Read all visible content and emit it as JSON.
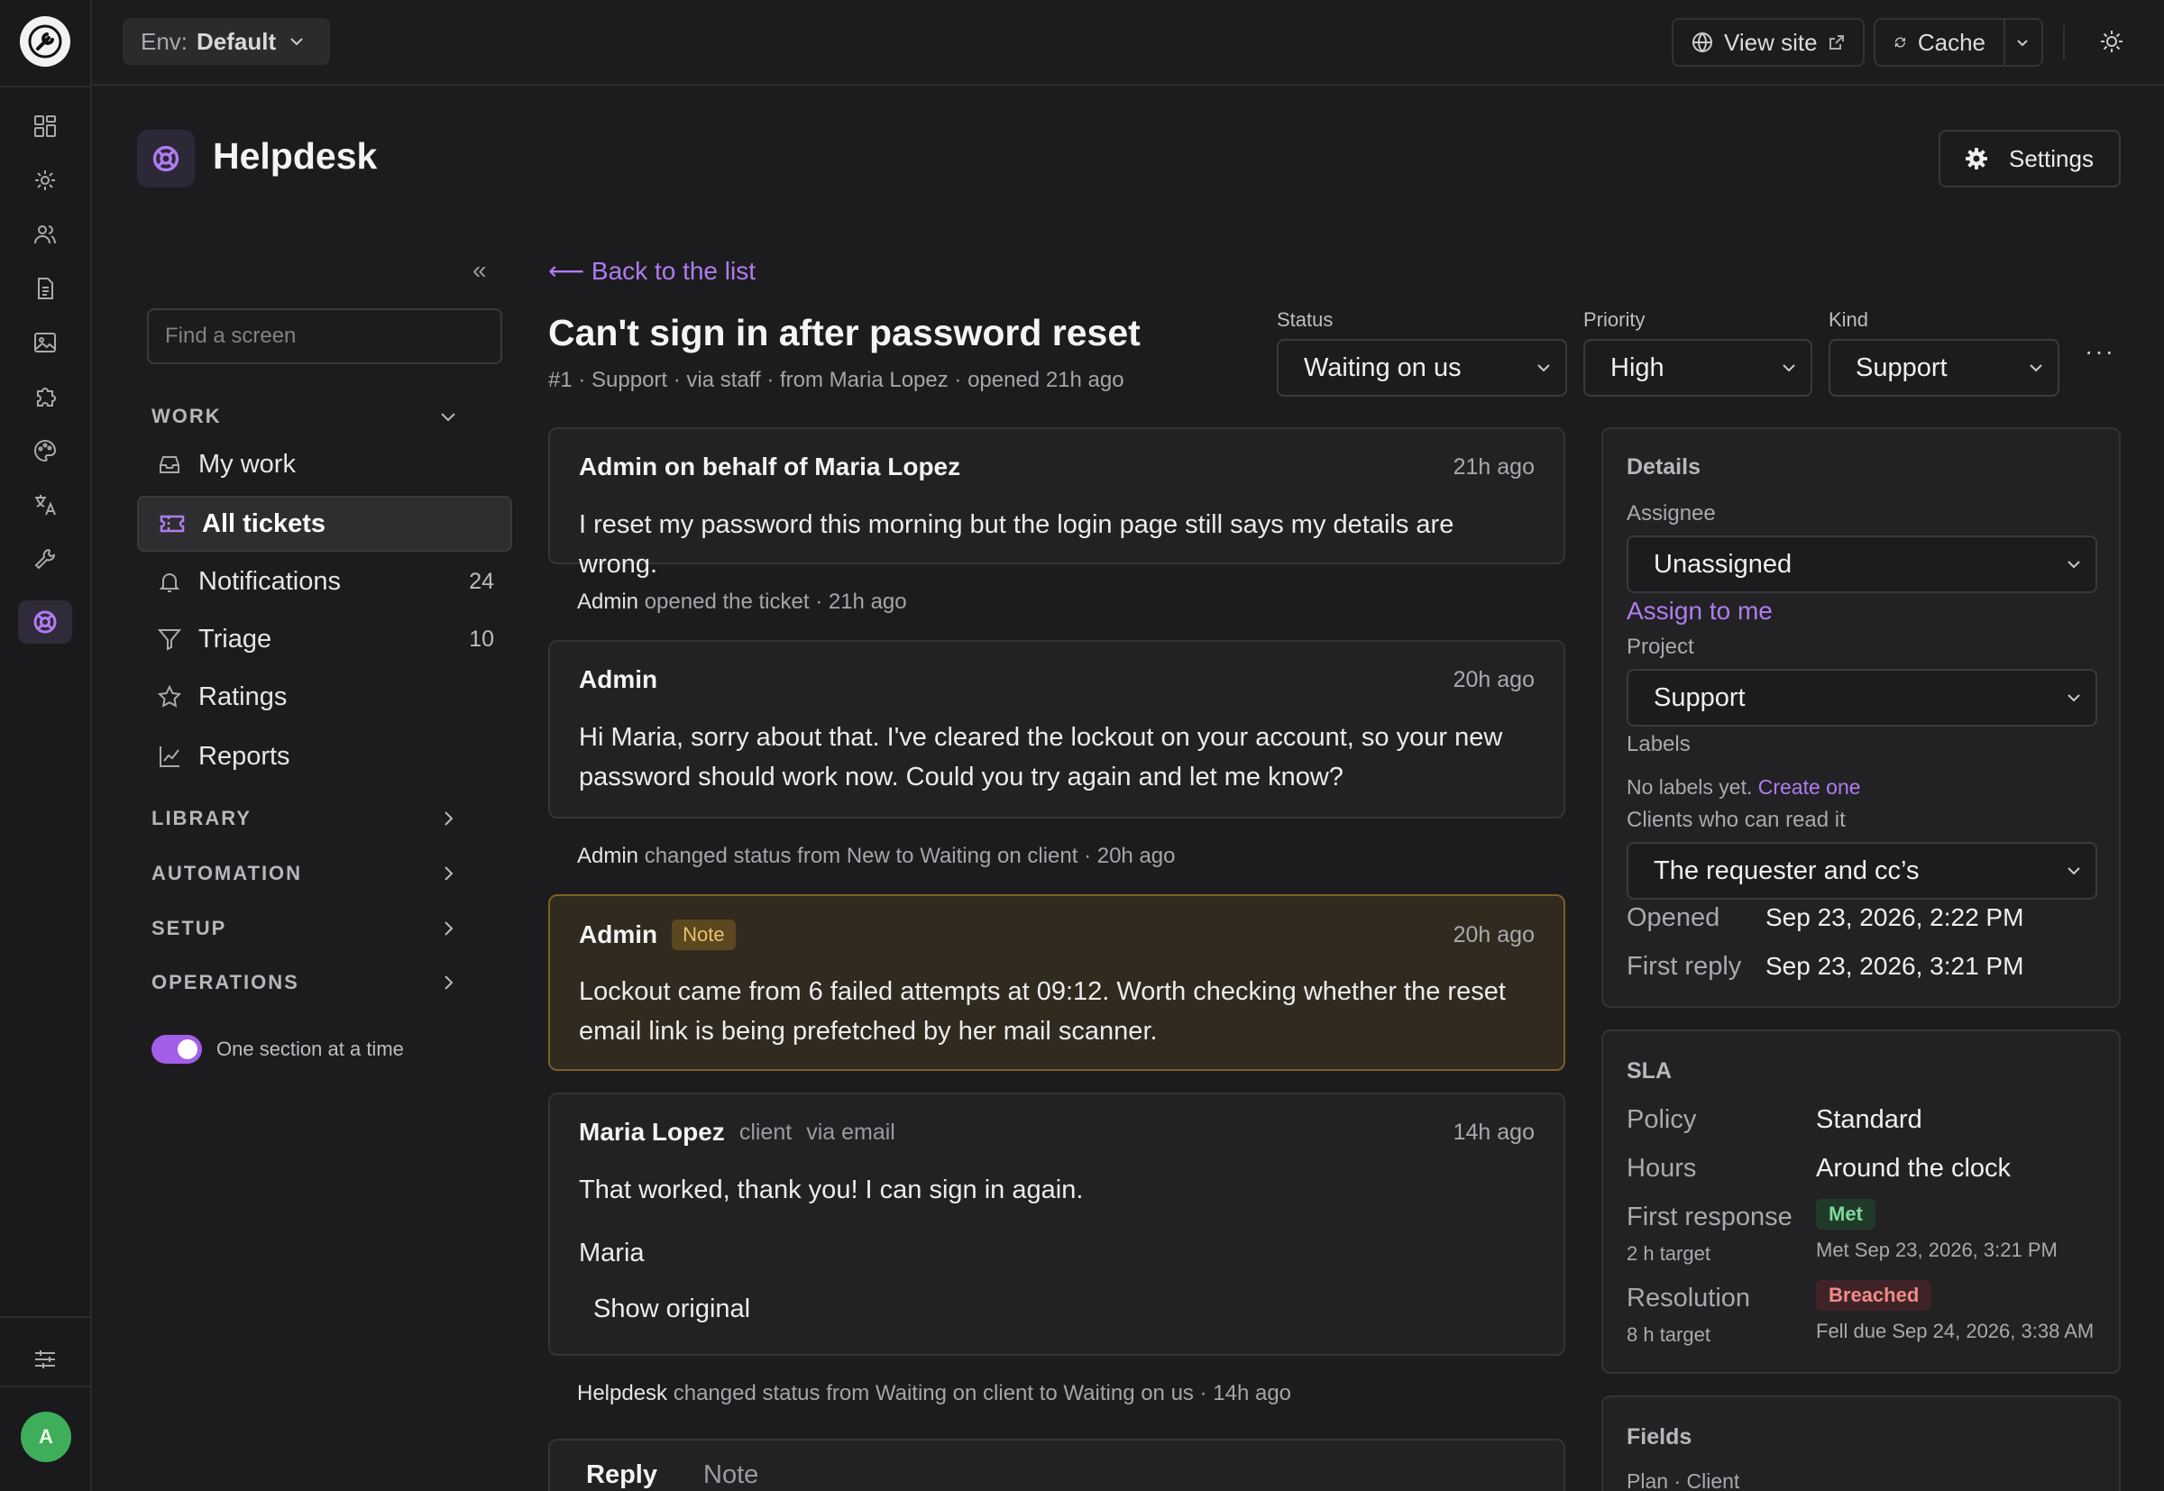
{
  "topbar": {
    "env_label": "Env:",
    "env_value": "Default",
    "view_site": "View site",
    "cache": "Cache"
  },
  "page": {
    "title": "Helpdesk",
    "settings": "Settings"
  },
  "sidebar": {
    "search_placeholder": "Find a screen",
    "work_label": "WORK",
    "items": [
      {
        "label": "My work",
        "count": "",
        "icon": "inbox-icon"
      },
      {
        "label": "All tickets",
        "count": "",
        "icon": "ticket-icon"
      },
      {
        "label": "Notifications",
        "count": "24",
        "icon": "bell-icon"
      },
      {
        "label": "Triage",
        "count": "10",
        "icon": "filter-icon"
      },
      {
        "label": "Ratings",
        "count": "",
        "icon": "star-icon"
      },
      {
        "label": "Reports",
        "count": "",
        "icon": "chart-icon"
      }
    ],
    "sections": [
      "LIBRARY",
      "AUTOMATION",
      "SETUP",
      "OPERATIONS"
    ],
    "toggle_label": "One section at a time",
    "toggle_on": true
  },
  "ticket": {
    "back": "⟵ Back to the list",
    "title": "Can't sign in after password reset",
    "meta": "#1 · Support · via staff · from Maria Lopez · opened 21h ago",
    "status_label": "Status",
    "status_value": "Waiting on us",
    "priority_label": "Priority",
    "priority_value": "High",
    "kind_label": "Kind",
    "kind_value": "Support",
    "more": "···"
  },
  "timeline": {
    "msg1": {
      "author": "Admin on behalf of Maria Lopez",
      "time": "21h ago",
      "body": "I reset my password this morning but the login page still says my details are wrong."
    },
    "event1": {
      "who": "Admin",
      "text": "opened the ticket",
      "time": "21h ago"
    },
    "msg2": {
      "author": "Admin",
      "time": "20h ago",
      "body": "Hi Maria, sorry about that. I've cleared the lockout on your account, so your new password should work now. Could you try again and let me know?"
    },
    "event2": {
      "who": "Admin",
      "text": "changed status from New to Waiting on client",
      "time": "20h ago"
    },
    "msg3": {
      "author": "Admin",
      "badge": "Note",
      "time": "20h ago",
      "body": "Lockout came from 6 failed attempts at 09:12. Worth checking whether the reset email link is being prefetched by her mail scanner."
    },
    "msg4": {
      "author": "Maria Lopez",
      "role": "client",
      "via": "via email",
      "time": "14h ago",
      "body": "That worked, thank you! I can sign in again.",
      "signature": "Maria",
      "show_original": "Show original"
    },
    "event3": {
      "who": "Helpdesk",
      "text": "changed status from Waiting on client to Waiting on us",
      "time": "14h ago"
    },
    "separator": "·"
  },
  "reply": {
    "tab_reply": "Reply",
    "tab_note": "Note"
  },
  "details": {
    "title": "Details",
    "assignee_label": "Assignee",
    "assignee_value": "Unassigned",
    "assign_to_me": "Assign to me",
    "project_label": "Project",
    "project_value": "Support",
    "labels_label": "Labels",
    "no_labels": "No labels yet.",
    "create_one": "Create one",
    "clients_label": "Clients who can read it",
    "clients_value": "The requester and cc’s",
    "opened_label": "Opened",
    "opened_value": "Sep 23, 2026, 2:22 PM",
    "first_reply_label": "First reply",
    "first_reply_value": "Sep 23, 2026, 3:21 PM"
  },
  "sla": {
    "title": "SLA",
    "policy_label": "Policy",
    "policy_value": "Standard",
    "hours_label": "Hours",
    "hours_value": "Around the clock",
    "first_response_label": "First response",
    "first_response_target": "2 h target",
    "first_response_status": "Met",
    "first_response_detail": "Met Sep 23, 2026, 3:21 PM",
    "resolution_label": "Resolution",
    "resolution_target": "8 h target",
    "resolution_status": "Breached",
    "resolution_detail": "Fell due Sep 24, 2026, 3:38 AM"
  },
  "fields": {
    "title": "Fields",
    "plan": "Plan",
    "plan_scope": "· Client"
  },
  "user": {
    "avatar_initial": "A"
  },
  "colors": {
    "accent": "#b07cf0",
    "note_border": "#7a6124",
    "met": "#7fd89b",
    "breached": "#ef8a8a"
  }
}
